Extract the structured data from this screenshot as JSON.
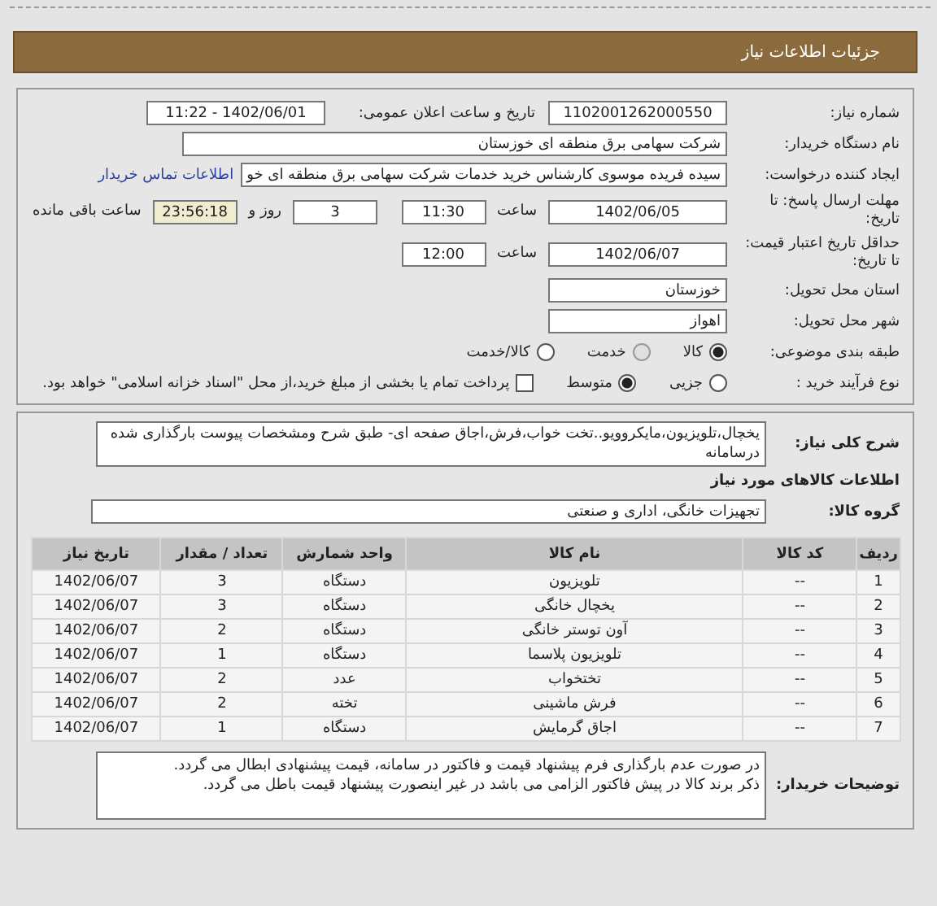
{
  "header": {
    "title": "جزئیات اطلاعات نیاز"
  },
  "need_number": {
    "label": "شماره نیاز:",
    "value": "1102001262000550"
  },
  "announce": {
    "label": "تاریخ و ساعت اعلان عمومی:",
    "value": "1402/06/01 - 11:22"
  },
  "buyer": {
    "label": "نام دستگاه خریدار:",
    "value": "شرکت سهامی برق منطقه ای خوزستان"
  },
  "creator": {
    "label": "ایجاد کننده درخواست:",
    "value": "سیده فریده موسوی کارشناس خرید خدمات شرکت سهامی برق منطقه ای خو",
    "link": "اطلاعات تماس خریدار"
  },
  "deadline": {
    "label": "مهلت ارسال پاسخ: تا تاریخ:",
    "date": "1402/06/05",
    "time_label": "ساعت",
    "time": "11:30",
    "days": "3",
    "days_label": "روز و",
    "remaining": "23:56:18",
    "remaining_label": "ساعت باقی مانده"
  },
  "validity": {
    "label": "حداقل تاریخ اعتبار قیمت: تا تاریخ:",
    "date": "1402/06/07",
    "time_label": "ساعت",
    "time": "12:00"
  },
  "province": {
    "label": "استان محل تحویل:",
    "value": "خوزستان"
  },
  "city": {
    "label": "شهر محل تحویل:",
    "value": "اهواز"
  },
  "category": {
    "label": "طبقه بندی موضوعی:",
    "options": [
      {
        "label": "کالا",
        "selected": true,
        "disabled": false
      },
      {
        "label": "خدمت",
        "selected": false,
        "disabled": true
      },
      {
        "label": "کالا/خدمت",
        "selected": false,
        "disabled": false
      }
    ]
  },
  "purchase": {
    "label": "نوع فرآیند خرید :",
    "options": [
      {
        "label": "جزیی",
        "selected": false
      },
      {
        "label": "متوسط",
        "selected": true
      }
    ],
    "checkbox": {
      "label": "پرداخت تمام یا بخشی از مبلغ خرید،از محل \"اسناد خزانه اسلامی\" خواهد بود.",
      "checked": false
    }
  },
  "description": {
    "label": "شرح کلی نیاز:",
    "value": "یخچال،تلویزیون،مایکروویو..تخت خواب،فرش،اجاق صفحه ای- طبق شرح ومشخصات پیوست بارگذاری شده درسامانه"
  },
  "items_heading": "اطلاعات کالاهای مورد نیاز",
  "goods_group": {
    "label": "گروه کالا:",
    "value": "تجهیزات خانگی، اداری و صنعتی"
  },
  "table": {
    "columns": [
      "ردیف",
      "کد کالا",
      "نام کالا",
      "واحد شمارش",
      "تعداد / مقدار",
      "تاریخ نیاز"
    ],
    "rows": [
      [
        "1",
        "--",
        "تلویزیون",
        "دستگاه",
        "3",
        "1402/06/07"
      ],
      [
        "2",
        "--",
        "یخچال خانگی",
        "دستگاه",
        "3",
        "1402/06/07"
      ],
      [
        "3",
        "--",
        "آون توستر خانگی",
        "دستگاه",
        "2",
        "1402/06/07"
      ],
      [
        "4",
        "--",
        "تلویزیون پلاسما",
        "دستگاه",
        "1",
        "1402/06/07"
      ],
      [
        "5",
        "--",
        "تختخواب",
        "عدد",
        "2",
        "1402/06/07"
      ],
      [
        "6",
        "--",
        "فرش ماشینی",
        "تخته",
        "2",
        "1402/06/07"
      ],
      [
        "7",
        "--",
        "اجاق گرمایش",
        "دستگاه",
        "1",
        "1402/06/07"
      ]
    ]
  },
  "notes": {
    "label": "توضیحات خریدار:",
    "lines": [
      "در صورت عدم بارگذاری فرم پیشنهاد قیمت و فاکتور در سامانه، قیمت پیشنهادی ابطال می گردد.",
      "ذکر برند کالا در پیش فاکتور الزامی می باشد در غیر اینصورت پیشنهاد قیمت باطل می گردد."
    ]
  }
}
